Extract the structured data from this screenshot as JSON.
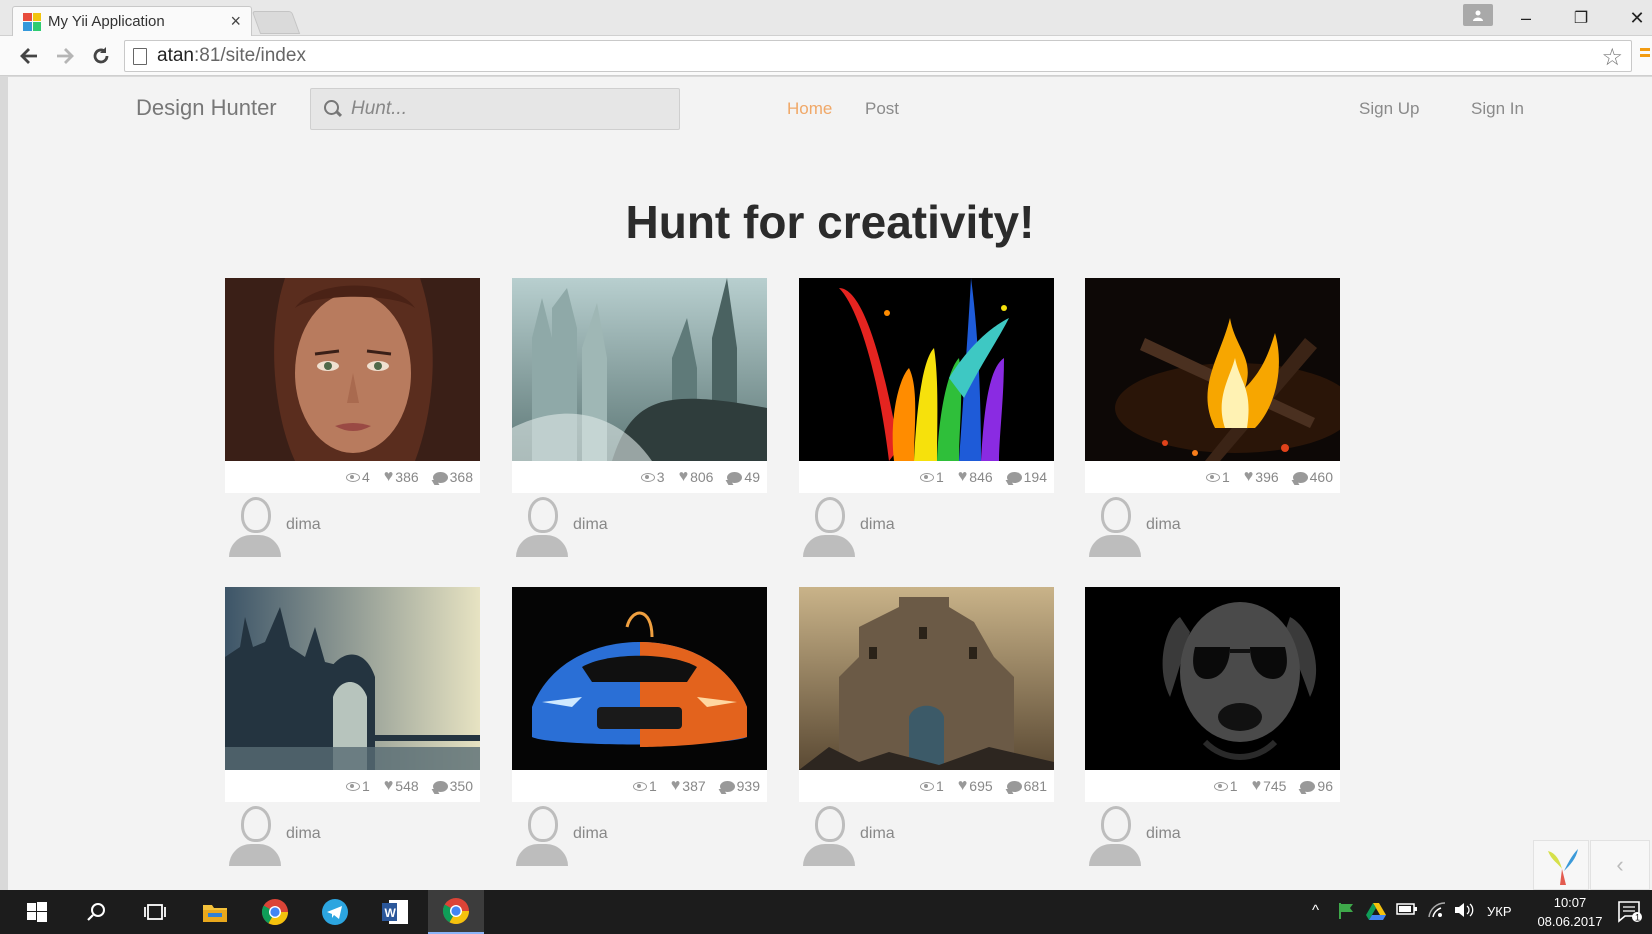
{
  "browser": {
    "tab_title": "My Yii Application",
    "tab_close": "×",
    "url_host": "atan",
    "url_rest": ":81/site/index",
    "icons": {
      "back": "back-arrow-icon",
      "forward": "forward-arrow-icon",
      "reload": "reload-icon",
      "bookmark": "star-icon",
      "menu": "menu-icon"
    }
  },
  "window_controls": {
    "minimize": "–",
    "restore": "❐",
    "close": "✕"
  },
  "site": {
    "brand": "Design Hunter",
    "search": {
      "placeholder": "Hunt...",
      "value": ""
    },
    "nav": [
      {
        "label": "Home",
        "active": true
      },
      {
        "label": "Post",
        "active": false
      }
    ],
    "auth": {
      "sign_up": "Sign Up",
      "sign_in": "Sign In"
    },
    "hero_title": "Hunt for creativity!",
    "accent_color": "#f0a868"
  },
  "posts": [
    {
      "views": "4",
      "likes": "386",
      "comments": "368",
      "author": "dima",
      "image": "portrait-of-woman"
    },
    {
      "views": "3",
      "likes": "806",
      "comments": "49",
      "author": "dima",
      "image": "fantasy-ice-city"
    },
    {
      "views": "1",
      "likes": "846",
      "comments": "194",
      "author": "dima",
      "image": "rainbow-paint-splash"
    },
    {
      "views": "1",
      "likes": "396",
      "comments": "460",
      "author": "dima",
      "image": "campfire"
    },
    {
      "views": "1",
      "likes": "548",
      "comments": "350",
      "author": "dima",
      "image": "gothic-castle-by-sea"
    },
    {
      "views": "1",
      "likes": "387",
      "comments": "939",
      "author": "dima",
      "image": "fire-and-ice-sports-car"
    },
    {
      "views": "1",
      "likes": "695",
      "comments": "681",
      "author": "dima",
      "image": "fortress-battle"
    },
    {
      "views": "1",
      "likes": "745",
      "comments": "96",
      "author": "dima",
      "image": "dog-with-sunglasses"
    }
  ],
  "debug_toolbar": {
    "collapse": "‹"
  },
  "taskbar": {
    "language": "УКР",
    "time": "10:07",
    "date": "08.06.2017",
    "notification_count": "1"
  }
}
